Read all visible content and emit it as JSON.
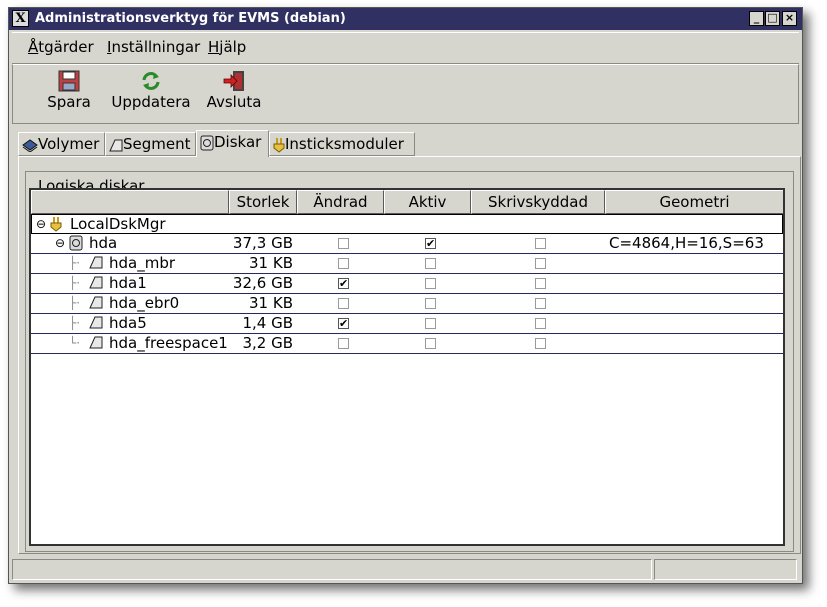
{
  "window": {
    "title": "Administrationsverktyg för EVMS (debian)"
  },
  "menu": {
    "items": [
      {
        "label": "Åtgärder",
        "mnemonic": "Å",
        "rest": "tgärder"
      },
      {
        "label": "Inställningar",
        "mnemonic": "I",
        "rest": "nställningar"
      },
      {
        "label": "Hjälp",
        "mnemonic": "H",
        "rest": "jälp"
      }
    ]
  },
  "toolbar": {
    "save": "Spara",
    "refresh": "Uppdatera",
    "quit": "Avsluta"
  },
  "tabs": [
    {
      "label": "Volymer",
      "icon": "volume-icon"
    },
    {
      "label": "Segment",
      "icon": "segment-icon"
    },
    {
      "label": "Diskar",
      "icon": "disk-icon"
    },
    {
      "label": "Insticksmoduler",
      "icon": "plugin-icon"
    }
  ],
  "active_tab": "Diskar",
  "group_label": "Logiska diskar",
  "columns": [
    "",
    "Storlek",
    "Ändrad",
    "Aktiv",
    "Skrivskyddad",
    "Geometri"
  ],
  "rows": [
    {
      "name": "LocalDskMgr",
      "level": 0,
      "icon": "plugin-icon",
      "size": "",
      "changed": null,
      "active": null,
      "readonly": null,
      "geometry": ""
    },
    {
      "name": "hda",
      "level": 1,
      "icon": "disk-icon",
      "size": "37,3 GB",
      "changed": false,
      "active": true,
      "readonly": false,
      "geometry": "C=4864,H=16,S=63"
    },
    {
      "name": "hda_mbr",
      "level": 2,
      "icon": "segment-icon",
      "size": "31 KB",
      "changed": false,
      "active": false,
      "readonly": false,
      "geometry": ""
    },
    {
      "name": "hda1",
      "level": 2,
      "icon": "segment-icon",
      "size": "32,6 GB",
      "changed": true,
      "active": false,
      "readonly": false,
      "geometry": ""
    },
    {
      "name": "hda_ebr0",
      "level": 2,
      "icon": "segment-icon",
      "size": "31 KB",
      "changed": false,
      "active": false,
      "readonly": false,
      "geometry": ""
    },
    {
      "name": "hda5",
      "level": 2,
      "icon": "segment-icon",
      "size": "1,4 GB",
      "changed": true,
      "active": false,
      "readonly": false,
      "geometry": ""
    },
    {
      "name": "hda_freespace1",
      "level": 2,
      "icon": "segment-icon",
      "size": "3,2 GB",
      "changed": false,
      "active": false,
      "readonly": false,
      "geometry": ""
    }
  ],
  "colors": {
    "titlebar": "#303062",
    "window_bg": "#d6d6ce",
    "row_line": "#28285a"
  }
}
